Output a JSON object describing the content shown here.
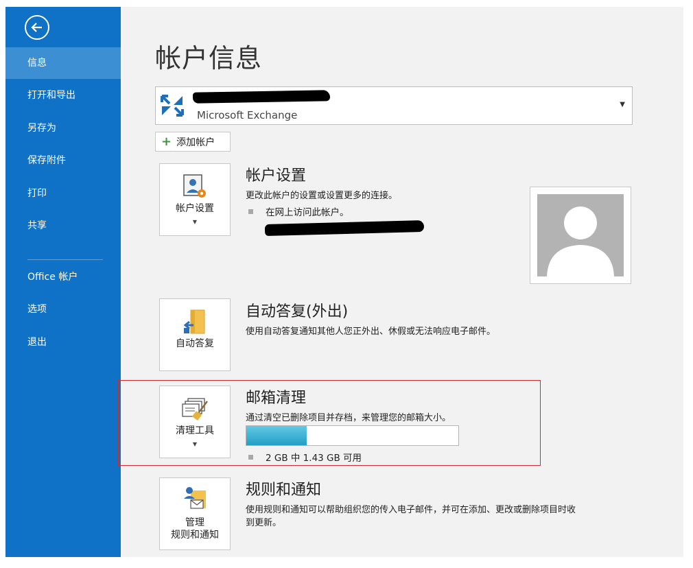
{
  "nav": {
    "items": [
      {
        "label": "信息",
        "active": true
      },
      {
        "label": "打开和导出"
      },
      {
        "label": "另存为"
      },
      {
        "label": "保存附件"
      },
      {
        "label": "打印"
      },
      {
        "label": "共享"
      },
      {
        "label": "Office 帐户"
      },
      {
        "label": "选项"
      },
      {
        "label": "退出"
      }
    ]
  },
  "page": {
    "title": "帐户信息"
  },
  "account": {
    "type": "Microsoft Exchange"
  },
  "add_account": {
    "label": "添加帐户"
  },
  "sections": {
    "account_settings": {
      "tile_label": "帐户设置",
      "title": "帐户设置",
      "desc": "更改此帐户的设置或设置更多的连接。",
      "bullet": "在网上访问此帐户。"
    },
    "auto_reply": {
      "tile_label": "自动答复",
      "title": "自动答复(外出)",
      "desc": "使用自动答复通知其他人您正外出、休假或无法响应电子邮件。"
    },
    "cleanup": {
      "tile_label": "清理工具",
      "title": "邮箱清理",
      "desc": "通过清空已删除项目并存档，来管理您的邮箱大小。",
      "quota_text": "2 GB 中 1.43 GB 可用",
      "quota_used_fraction": 0.285
    },
    "rules": {
      "tile_label_line1": "管理",
      "tile_label_line2": "规则和通知",
      "title": "规则和通知",
      "desc_line1": "使用规则和通知可以帮助组织您的传入电子邮件，并可在添加、更改或删除项目时收",
      "desc_line2": "到更新。"
    }
  },
  "colors": {
    "sidebar": "#0f72c6",
    "sidebar_active": "#3d8fd4",
    "highlight": "#d0282b",
    "quota_fill": "#2aa6cc"
  }
}
